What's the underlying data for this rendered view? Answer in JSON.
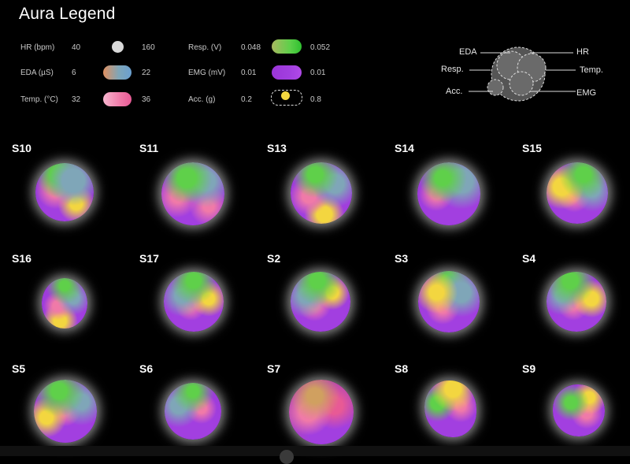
{
  "title": "Aura Legend",
  "legend": {
    "hr": {
      "label": "HR (bpm)",
      "min": "40",
      "max": "160"
    },
    "eda": {
      "label": "EDA (µS)",
      "min": "6",
      "max": "22"
    },
    "temp": {
      "label": "Temp. (°C)",
      "min": "32",
      "max": "36"
    },
    "resp": {
      "label": "Resp. (V)",
      "min": "0.048",
      "max": "0.052"
    },
    "emg": {
      "label": "EMG (mV)",
      "min": "0.01",
      "max": "0.01"
    },
    "acc": {
      "label": "Acc. (g)",
      "min": "0.2",
      "max": "0.8"
    }
  },
  "diagram": {
    "eda": "EDA",
    "hr": "HR",
    "resp": "Resp.",
    "temp": "Temp.",
    "acc": "Acc.",
    "emg": "EMG"
  },
  "colors": {
    "background": "#000000",
    "hr": "#d9d9d9",
    "eda": "#7fa6b8",
    "temp": "#f07aa8",
    "resp": "#5fd04a",
    "emg": "#a23fe0",
    "acc": "#f3d640"
  },
  "subjects": [
    {
      "id": "S10"
    },
    {
      "id": "S11"
    },
    {
      "id": "S13"
    },
    {
      "id": "S14"
    },
    {
      "id": "S15"
    },
    {
      "id": "S16"
    },
    {
      "id": "S17"
    },
    {
      "id": "S2"
    },
    {
      "id": "S3"
    },
    {
      "id": "S4"
    },
    {
      "id": "S5"
    },
    {
      "id": "S6"
    },
    {
      "id": "S7"
    },
    {
      "id": "S8"
    },
    {
      "id": "S9"
    }
  ]
}
